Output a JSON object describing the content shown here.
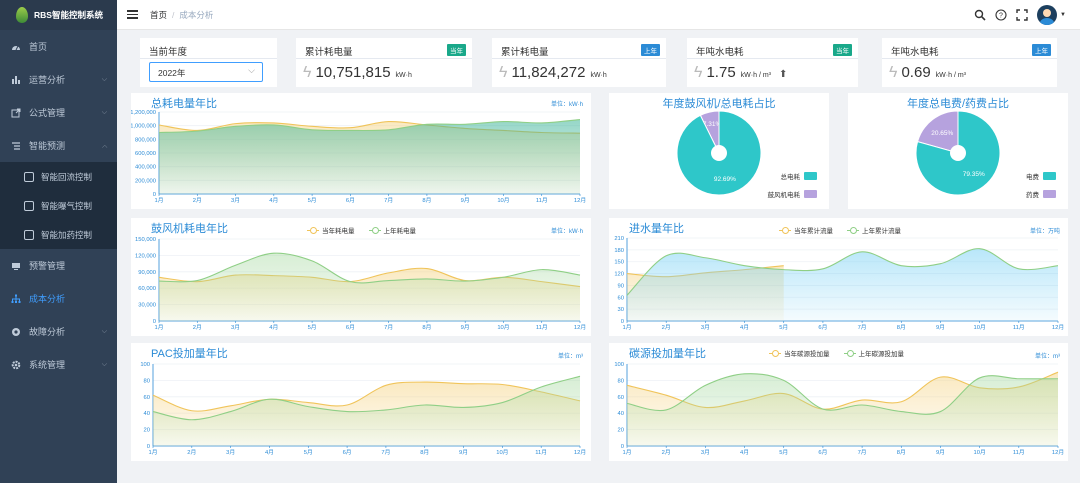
{
  "app": {
    "title": "RBS智能控制系统"
  },
  "sidebar": {
    "items": [
      {
        "label": "首页",
        "icon": "dashboard-icon",
        "chevron": false
      },
      {
        "label": "运营分析",
        "icon": "bar-chart-icon",
        "chevron": true
      },
      {
        "label": "公式管理",
        "icon": "external-link-icon",
        "chevron": true
      },
      {
        "label": "智能预测",
        "icon": "list-icon",
        "chevron": true
      },
      {
        "label": "预警管理",
        "icon": "monitor-icon",
        "chevron": false
      },
      {
        "label": "成本分析",
        "icon": "org-chart-icon",
        "chevron": false,
        "active": true
      },
      {
        "label": "故障分析",
        "icon": "gear-circle-icon",
        "chevron": true
      },
      {
        "label": "系统管理",
        "icon": "gear-icon",
        "chevron": true
      }
    ],
    "sub_items": [
      {
        "label": "智能回流控制"
      },
      {
        "label": "智能曝气控制"
      },
      {
        "label": "智能加药控制"
      }
    ]
  },
  "breadcrumb": {
    "home": "首页",
    "separator": "/",
    "current": "成本分析"
  },
  "stats": {
    "year": {
      "title": "当前年度",
      "value": "2022年"
    },
    "card1": {
      "title": "累计耗电量",
      "badge": "当年",
      "badge_color": "#19a88a",
      "value": "10,751,815",
      "unit": "kW·h"
    },
    "card2": {
      "title": "累计耗电量",
      "badge": "上年",
      "badge_color": "#2b8bd6",
      "value": "11,824,272",
      "unit": "kW·h"
    },
    "card3": {
      "title": "年吨水电耗",
      "badge": "当年",
      "badge_color": "#19a88a",
      "value": "1.75",
      "unit": "kW·h / m³",
      "trend": "up"
    },
    "card4": {
      "title": "年吨水电耗",
      "badge": "上年",
      "badge_color": "#2b8bd6",
      "value": "0.69",
      "unit": "kW·h / m³"
    }
  },
  "colors": {
    "yellow": "#f0c45a",
    "green": "#8fcf86",
    "teal": "#2ec7c9",
    "purple": "#b6a2de",
    "accent": "#2b8bd6"
  },
  "chart_data": [
    {
      "id": "total",
      "type": "area",
      "title": "总耗电量年比",
      "unit": "单位：kW·h",
      "categories": [
        "1月",
        "2月",
        "3月",
        "4月",
        "5月",
        "6月",
        "7月",
        "8月",
        "9月",
        "10月",
        "11月",
        "12月"
      ],
      "ylim": [
        0,
        1200000
      ],
      "yticks": [
        "0",
        "200,000",
        "400,000",
        "600,000",
        "800,000",
        "1,000,000",
        "1,200,000"
      ],
      "legend": [],
      "series": [
        {
          "values": [
            1010000,
            930000,
            1030000,
            1040000,
            990000,
            970000,
            1060000,
            1010000,
            960000,
            930000,
            900000,
            890000
          ],
          "color": "#f0c45a"
        },
        {
          "values": [
            900000,
            920000,
            990000,
            1010000,
            940000,
            930000,
            940000,
            1020000,
            1020000,
            1060000,
            1040000,
            1090000
          ],
          "color": "#8fcf86",
          "fill": "teal"
        }
      ]
    },
    {
      "id": "fan",
      "type": "area",
      "title": "鼓风机耗电年比",
      "unit": "单位：kW·h",
      "categories": [
        "1月",
        "2月",
        "3月",
        "4月",
        "5月",
        "6月",
        "7月",
        "8月",
        "9月",
        "10月",
        "11月",
        "12月"
      ],
      "ylim": [
        0,
        150000
      ],
      "yticks": [
        "0",
        "30,000",
        "60,000",
        "90,000",
        "120,000",
        "150,000"
      ],
      "legend": [
        "当年耗电量",
        "上年耗电量"
      ],
      "series": [
        {
          "name": "当年耗电量",
          "values": [
            80000,
            72000,
            84000,
            83000,
            80000,
            72000,
            88000,
            96000,
            74000,
            80000,
            72000,
            63000
          ],
          "color": "#f0c45a"
        },
        {
          "name": "上年耗电量",
          "values": [
            73000,
            74000,
            102000,
            124000,
            110000,
            72000,
            74000,
            77000,
            73000,
            80000,
            94000,
            84000
          ],
          "color": "#8fcf86"
        }
      ]
    },
    {
      "id": "water",
      "type": "area",
      "title": "进水量年比",
      "unit": "单位：万吨",
      "categories": [
        "1月",
        "2月",
        "3月",
        "4月",
        "5月",
        "6月",
        "7月",
        "8月",
        "9月",
        "10月",
        "11月",
        "12月"
      ],
      "ylim": [
        0,
        210
      ],
      "yticks": [
        "0",
        "30",
        "60",
        "90",
        "120",
        "150",
        "180",
        "210"
      ],
      "legend": [
        "当年累计流量",
        "上年累计流量"
      ],
      "series": [
        {
          "name": "当年累计流量",
          "values": [
            120,
            112,
            122,
            130,
            140
          ],
          "color": "#f0c45a"
        },
        {
          "name": "上年累计流量",
          "values": [
            65,
            165,
            160,
            140,
            130,
            132,
            175,
            140,
            145,
            183,
            132,
            140
          ],
          "color": "#8fcf86",
          "fill": "blue"
        }
      ]
    },
    {
      "id": "pac",
      "type": "area",
      "title": "PAC投加量年比",
      "unit": "单位：m³",
      "categories": [
        "1月",
        "2月",
        "3月",
        "4月",
        "5月",
        "6月",
        "7月",
        "8月",
        "9月",
        "10月",
        "11月",
        "12月"
      ],
      "ylim": [
        0,
        100
      ],
      "yticks": [
        "0",
        "20",
        "40",
        "60",
        "80",
        "100"
      ],
      "legend": [],
      "series": [
        {
          "values": [
            62,
            43,
            49,
            57,
            53,
            50,
            74,
            78,
            76,
            75,
            66,
            55
          ],
          "color": "#f0c45a"
        },
        {
          "values": [
            42,
            32,
            42,
            57,
            48,
            42,
            44,
            50,
            47,
            53,
            72,
            85
          ],
          "color": "#8fcf86"
        }
      ]
    },
    {
      "id": "carbon",
      "type": "area",
      "title": "碳源投加量年比",
      "unit": "单位：m³",
      "categories": [
        "1月",
        "2月",
        "3月",
        "4月",
        "5月",
        "6月",
        "7月",
        "8月",
        "9月",
        "10月",
        "11月",
        "12月"
      ],
      "ylim": [
        0,
        100
      ],
      "yticks": [
        "0",
        "20",
        "40",
        "60",
        "80",
        "100"
      ],
      "legend": [
        "当年碳源投加量",
        "上年碳源投加量"
      ],
      "series": [
        {
          "name": "当年碳源投加量",
          "values": [
            74,
            62,
            47,
            55,
            64,
            45,
            56,
            54,
            84,
            71,
            72,
            90
          ],
          "color": "#f0c45a"
        },
        {
          "name": "上年碳源投加量",
          "values": [
            52,
            44,
            74,
            88,
            80,
            45,
            50,
            42,
            42,
            83,
            82,
            82
          ],
          "color": "#8fcf86"
        }
      ]
    },
    {
      "id": "pie1",
      "type": "pie",
      "title": "年度鼓风机/总电耗占比",
      "slices": [
        {
          "label": "总电耗",
          "value": 92.69,
          "text": "92.69%",
          "color": "#2ec7c9"
        },
        {
          "label": "鼓风机电耗",
          "value": 7.31,
          "text": "7.31%",
          "color": "#b6a2de"
        }
      ]
    },
    {
      "id": "pie2",
      "type": "pie",
      "title": "年度总电费/药费占比",
      "slices": [
        {
          "label": "电费",
          "value": 79.35,
          "text": "79.35%",
          "color": "#2ec7c9"
        },
        {
          "label": "药费",
          "value": 20.65,
          "text": "20.65%",
          "color": "#b6a2de"
        }
      ]
    }
  ]
}
